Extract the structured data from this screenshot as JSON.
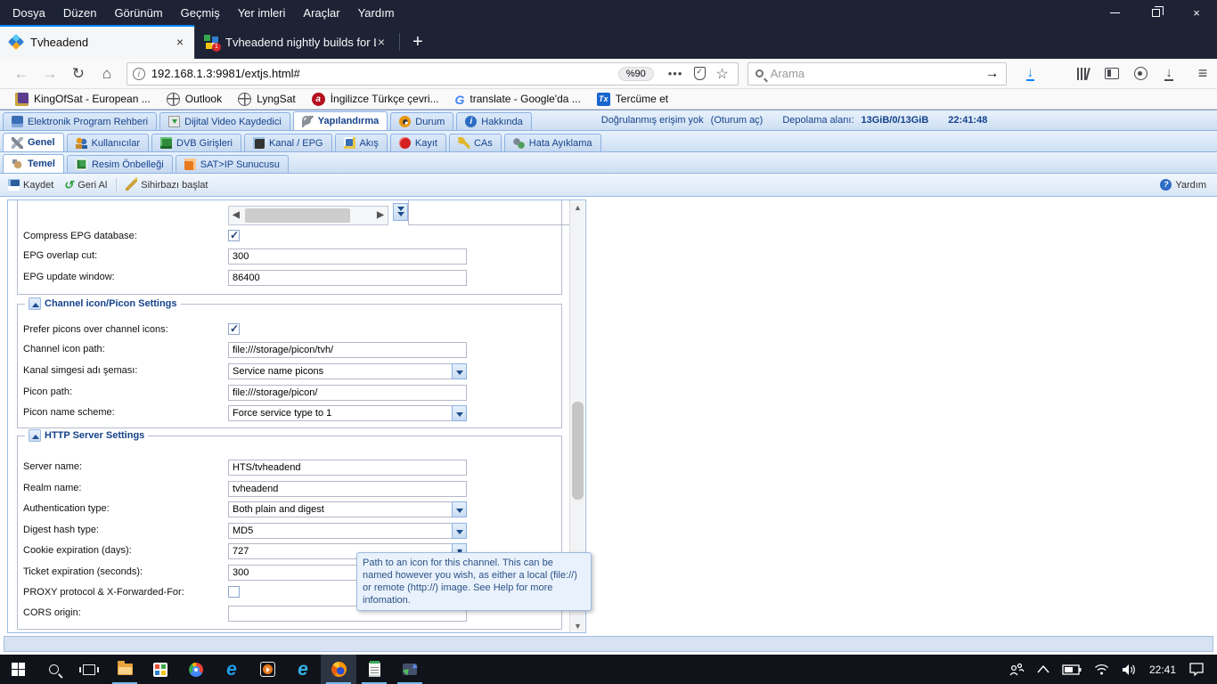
{
  "browser": {
    "menu": [
      "Dosya",
      "Düzen",
      "Görünüm",
      "Geçmiş",
      "Yer imleri",
      "Araçlar",
      "Yardım"
    ],
    "tabs": [
      {
        "title": "Tvheadend"
      },
      {
        "title": "Tvheadend nightly builds for LE"
      }
    ],
    "url": "192.168.1.3:9981/extjs.html#",
    "zoom_badge": "%90",
    "page_actions": "•••",
    "search_placeholder": "Arama",
    "bookmarks": [
      "KingOfSat - European ...",
      "Outlook",
      "LyngSat",
      "İngilizce Türkçe çevri...",
      "translate - Google'da ...",
      "Tercüme et"
    ]
  },
  "tvh": {
    "main_tabs": [
      "Elektronik Program Rehberi",
      "Dijital Video Kaydedici",
      "Yapılandırma",
      "Durum",
      "Hakkında"
    ],
    "status": {
      "auth": "Doğrulanmış erişim yok",
      "login": "(Oturum aç)",
      "storage_label": "Depolama alanı:",
      "storage_value": "13GiB/0/13GiB",
      "time": "22:41:48"
    },
    "config_tabs": [
      "Genel",
      "Kullanıcılar",
      "DVB Girişleri",
      "Kanal / EPG",
      "Akış",
      "Kayıt",
      "CAs",
      "Hata Ayıklama"
    ],
    "general_tabs": [
      "Temel",
      "Resim Önbelleği",
      "SAT>IP Sunucusu"
    ],
    "toolbar": {
      "save": "Kaydet",
      "undo": "Geri Al",
      "wizard": "Sihirbazı başlat",
      "help": "Yardım"
    },
    "form": {
      "epg_fields": [
        {
          "label": "Compress EPG database:",
          "type": "checkbox",
          "checked": true
        },
        {
          "label": "EPG overlap cut:",
          "value": "300"
        },
        {
          "label": "EPG update window:",
          "value": "86400"
        }
      ],
      "picon": {
        "legend": "Channel icon/Picon Settings",
        "fields": [
          {
            "label": "Prefer picons over channel icons:",
            "type": "checkbox",
            "checked": true
          },
          {
            "label": "Channel icon path:",
            "value": "file:///storage/picon/tvh/"
          },
          {
            "label": "Kanal simgesi adı şeması:",
            "value": "Service name picons"
          },
          {
            "label": "Picon path:",
            "value": "file:///storage/picon/"
          },
          {
            "label": "Picon name scheme:",
            "value": "Force service type to 1"
          }
        ]
      },
      "http": {
        "legend": "HTTP Server Settings",
        "fields": [
          {
            "label": "Server name:",
            "value": "HTS/tvheadend"
          },
          {
            "label": "Realm name:",
            "value": "tvheadend"
          },
          {
            "label": "Authentication type:",
            "value": "Both plain and digest"
          },
          {
            "label": "Digest hash type:",
            "value": "MD5"
          },
          {
            "label": "Cookie expiration (days):",
            "value": "727"
          },
          {
            "label": "Ticket expiration (seconds):",
            "value": "300"
          },
          {
            "label": "PROXY protocol & X-Forwarded-For:",
            "type": "checkbox",
            "checked": false
          },
          {
            "label": "CORS origin:",
            "value": ""
          }
        ]
      },
      "tooltip": "Path to an icon for this channel. This can be named however you wish, as either a local (file://) or remote (http://) image. See Help for more infomation."
    }
  },
  "taskbar": {
    "time": "22:41"
  }
}
